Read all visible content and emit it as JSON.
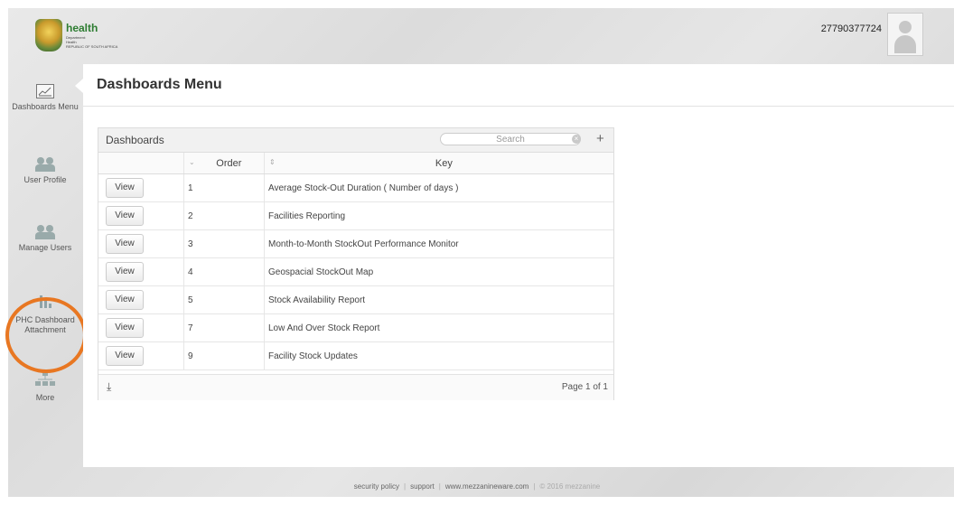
{
  "header": {
    "brand": "health",
    "brand_sub": [
      "Department:",
      "Health",
      "REPUBLIC OF SOUTH AFRICA"
    ],
    "user_id": "27790377724"
  },
  "sidebar": {
    "items": [
      {
        "label": "Dashboards Menu",
        "icon": "chart-icon"
      },
      {
        "label": "User Profile",
        "icon": "users-icon"
      },
      {
        "label": "Manage Users",
        "icon": "users-icon"
      },
      {
        "label": "PHC Dashboard Attachment",
        "icon": "bar-chart-icon"
      },
      {
        "label": "More",
        "icon": "sitemap-icon"
      }
    ],
    "highlight_color": "#e87722"
  },
  "main": {
    "title": "Dashboards Menu",
    "panel_title": "Dashboards",
    "search_placeholder": "Search",
    "columns": [
      "",
      "Order",
      "Key"
    ],
    "rows": [
      {
        "button": "View",
        "order": "1",
        "key": "Average Stock-Out Duration ( Number of days )"
      },
      {
        "button": "View",
        "order": "2",
        "key": "Facilities Reporting"
      },
      {
        "button": "View",
        "order": "3",
        "key": "Month-to-Month StockOut Performance Monitor"
      },
      {
        "button": "View",
        "order": "4",
        "key": "Geospacial StockOut Map"
      },
      {
        "button": "View",
        "order": "5",
        "key": "Stock Availability Report"
      },
      {
        "button": "View",
        "order": "7",
        "key": "Low And Over Stock Report"
      },
      {
        "button": "View",
        "order": "9",
        "key": "Facility Stock Updates"
      }
    ],
    "pagination": "Page 1 of 1"
  },
  "footer": {
    "links": [
      "security policy",
      "support",
      "www.mezzanineware.com"
    ],
    "copyright": "© 2016 mezzanine"
  }
}
